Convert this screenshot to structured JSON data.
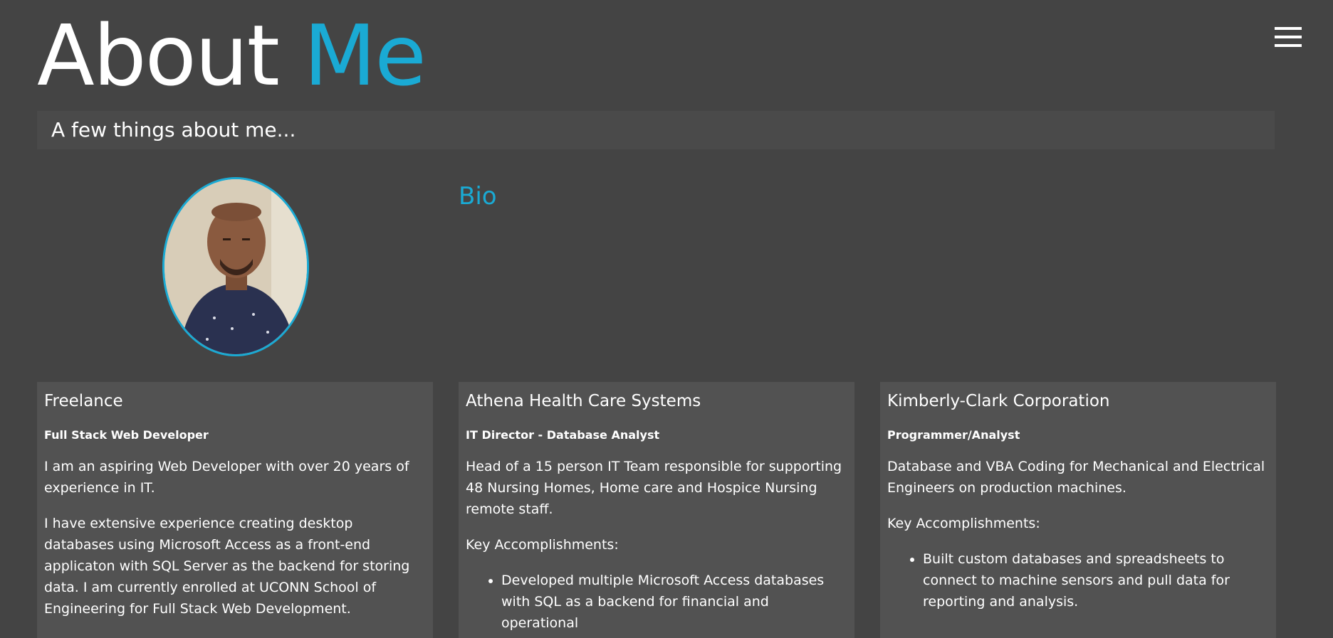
{
  "header": {
    "title_part1": "About",
    "title_part2": "Me",
    "menu_icon": "hamburger-icon"
  },
  "subtitle": "A few things about me...",
  "profile": {
    "bio_heading": "Bio"
  },
  "cards": [
    {
      "company": "Freelance",
      "role": "Full Stack Web Developer",
      "paragraphs": [
        "I am an aspiring Web Developer with over 20 years of experience in IT.",
        "I have extensive experience creating desktop databases using Microsoft Access as a front-end applicaton with SQL Server as the backend for storing data. I am currently enrolled at UCONN School of Engineering for Full Stack Web Development."
      ]
    },
    {
      "company": "Athena Health Care Systems",
      "role": "IT Director - Database Analyst",
      "paragraphs": [
        "Head of a 15 person IT Team responsible for supporting 48 Nursing Homes, Home care and Hospice Nursing remote staff.",
        "Key Accomplishments:"
      ],
      "bullets": [
        "Developed multiple Microsoft Access databases with SQL as a backend for financial and operational"
      ]
    },
    {
      "company": "Kimberly-Clark Corporation",
      "role": "Programmer/Analyst",
      "paragraphs": [
        "Database and VBA Coding for Mechanical and Electrical Engineers on production machines.",
        "Key Accomplishments:"
      ],
      "bullets": [
        "Built custom databases and spreadsheets to connect to machine sensors and pull data for reporting and analysis."
      ]
    }
  ],
  "colors": {
    "background": "#444444",
    "accent": "#1aaad4",
    "card": "#525252",
    "subtitle_bar": "#4a4a4a"
  }
}
